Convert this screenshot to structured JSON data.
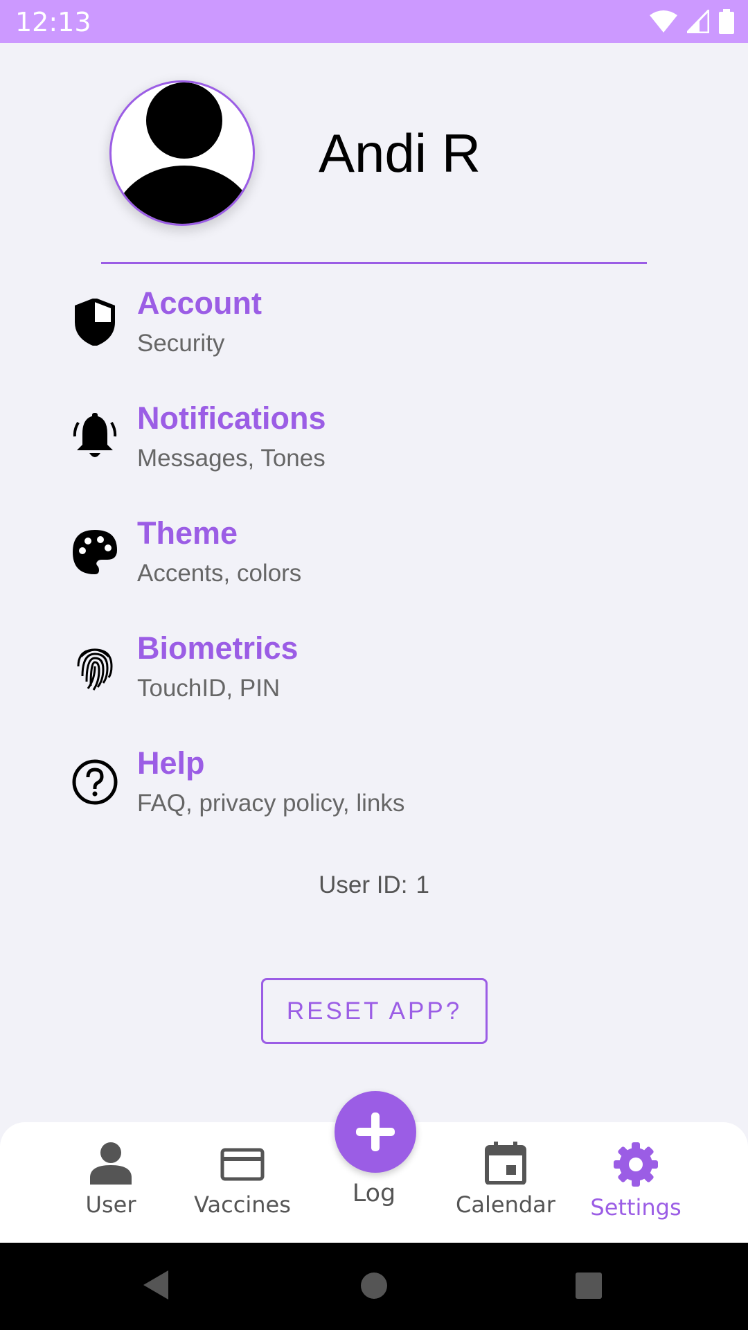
{
  "status_bar": {
    "time": "12:13",
    "bg_color": "#cc99ff",
    "icons": [
      "wifi-icon",
      "signal-icon",
      "battery-icon"
    ]
  },
  "profile": {
    "name": "Andi R",
    "avatar_icon": "person-icon"
  },
  "accent_color": "#9b5de5",
  "menu": [
    {
      "icon": "shield-icon",
      "title": "Account",
      "subtitle": "Security"
    },
    {
      "icon": "bell-icon",
      "title": "Notifications",
      "subtitle": "Messages, Tones"
    },
    {
      "icon": "palette-icon",
      "title": "Theme",
      "subtitle": "Accents, colors"
    },
    {
      "icon": "fingerprint-icon",
      "title": "Biometrics",
      "subtitle": "TouchID, PIN"
    },
    {
      "icon": "help-icon",
      "title": "Help",
      "subtitle": "FAQ, privacy policy, links"
    }
  ],
  "user_id": {
    "label": "User ID:",
    "value": "1"
  },
  "reset_button": {
    "label": "RESET APP?"
  },
  "bottom_nav": {
    "items": [
      {
        "label": "User",
        "icon": "person-icon",
        "active": false
      },
      {
        "label": "Vaccines",
        "icon": "card-icon",
        "active": false
      },
      {
        "label": "Log",
        "icon": "plus-icon",
        "active": false
      },
      {
        "label": "Calendar",
        "icon": "calendar-icon",
        "active": false
      },
      {
        "label": "Settings",
        "icon": "gear-icon",
        "active": true
      }
    ]
  },
  "system_nav": {
    "icons": [
      "back-icon",
      "home-icon",
      "recents-icon"
    ]
  }
}
